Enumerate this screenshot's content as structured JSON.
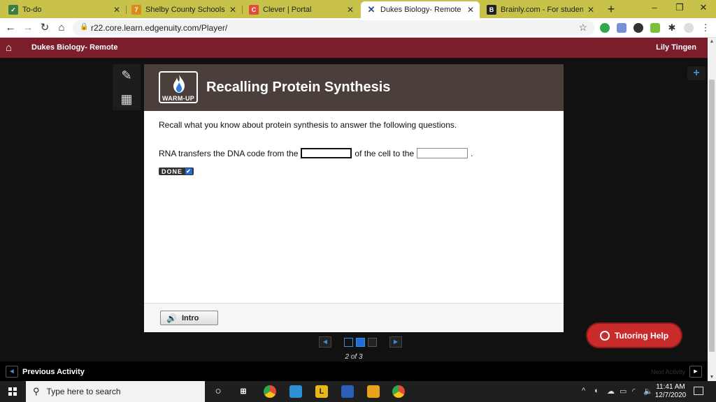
{
  "browser": {
    "tabs": [
      {
        "title": "To-do",
        "favicon": "todo-favicon",
        "color": "#3a7d44",
        "glyph": "✓"
      },
      {
        "title": "Shelby County Schools - Calen",
        "favicon": "calendar-favicon",
        "color": "#d98b1a",
        "glyph": "7"
      },
      {
        "title": "Clever | Portal",
        "favicon": "clever-favicon",
        "color": "#e34b3a",
        "glyph": "C"
      },
      {
        "title": "Dukes Biology- Remote - Edge",
        "favicon": "edgenuity-favicon",
        "color": "#2a4d8f",
        "glyph": "✕"
      },
      {
        "title": "Brainly.com - For students. By",
        "favicon": "brainly-favicon",
        "color": "#222222",
        "glyph": "B"
      }
    ],
    "new_tab": "+",
    "window_controls": {
      "minimize": "–",
      "restore": "❐",
      "close": "✕"
    },
    "nav": {
      "back": "←",
      "forward": "→",
      "reload": "↻",
      "home": "⌂"
    },
    "url": "r22.core.learn.edgenuity.com/Player/"
  },
  "app": {
    "course": "Dukes Biology- Remote",
    "user": "Lily Tingen",
    "colors": {
      "header": "#7b1d2a",
      "banner": "#4a3f3b",
      "accent": "#1e6fd9",
      "tutor": "#c92a2a"
    }
  },
  "lesson": {
    "badge_label": "WARM-UP",
    "title": "Recalling Protein Synthesis",
    "instructions": "Recall what you know about protein synthesis to answer the following questions.",
    "question": {
      "part1": "RNA transfers the DNA code from the",
      "blank1_value": "",
      "part2": "of the cell to the",
      "blank2_value": "",
      "part3": "."
    },
    "done_label": "DONE",
    "intro_label": "Intro"
  },
  "pager": {
    "count_text": "2 of 3"
  },
  "tutoring_label": "Tutoring Help",
  "activity_bar": {
    "prev_label": "Previous Activity",
    "next_label": "Next Activity"
  },
  "taskbar": {
    "search_placeholder": "Type here to search",
    "time": "11:41 AM",
    "date": "12/7/2020"
  }
}
